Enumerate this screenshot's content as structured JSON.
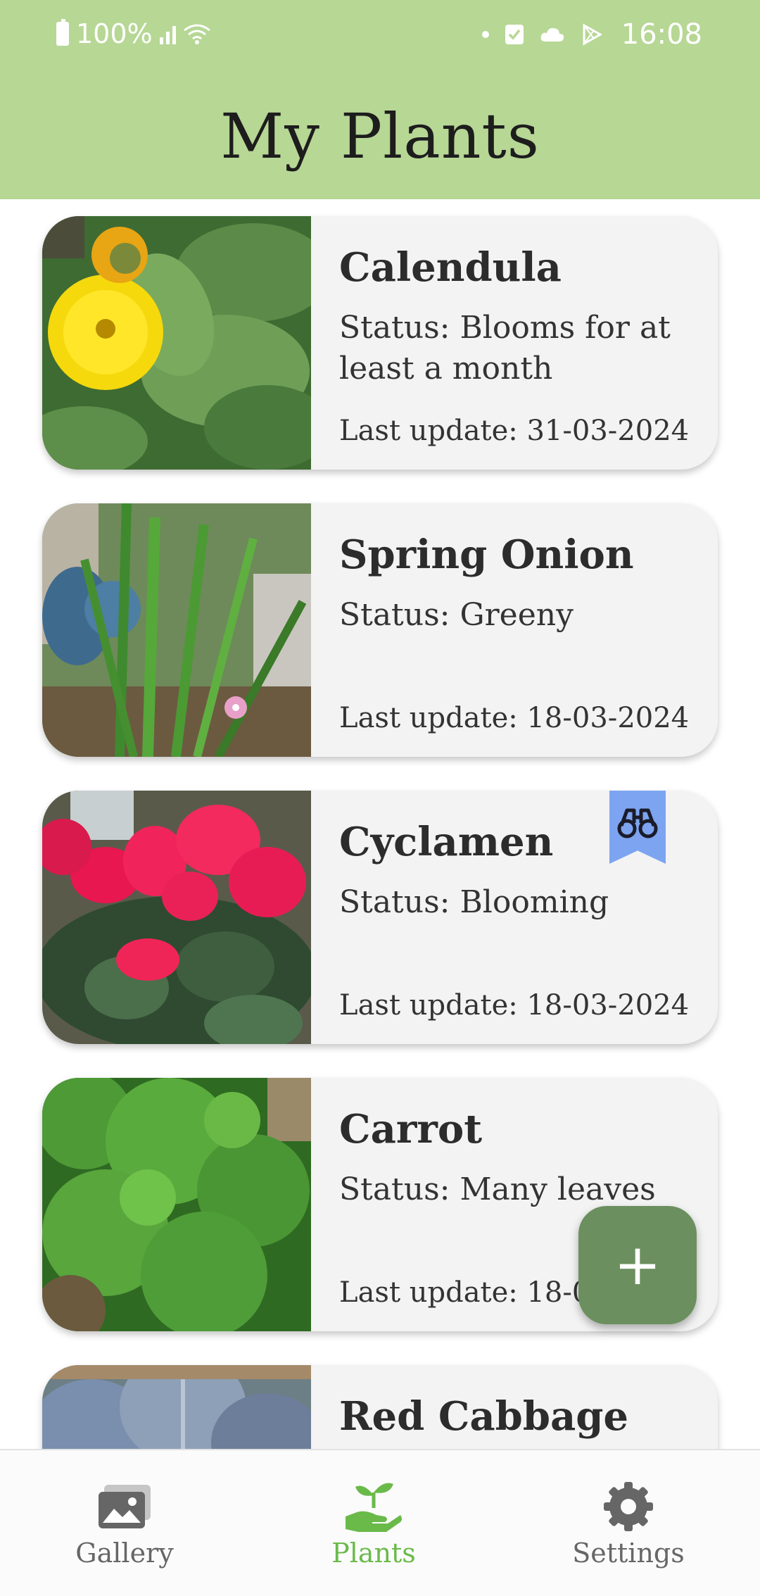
{
  "status_bar": {
    "battery": "100%",
    "time": "16:08"
  },
  "header": {
    "title": "My Plants"
  },
  "plants": [
    {
      "name": "Calendula",
      "status": "Status: Blooms for at least a month",
      "last_update": "Last update: 31-03-2024"
    },
    {
      "name": "Spring Onion",
      "status": "Status: Greeny",
      "last_update": "Last update: 18-03-2024"
    },
    {
      "name": "Cyclamen",
      "status": "Status: Blooming",
      "last_update": "Last update: 18-03-2024",
      "bookmark_icon": "binoculars-icon"
    },
    {
      "name": "Carrot",
      "status": "Status: Many leaves",
      "last_update": "Last update: 18-03-2024"
    },
    {
      "name": "Red Cabbage"
    }
  ],
  "fab": {
    "label": "+",
    "icon": "plus-icon"
  },
  "bottom_nav": {
    "items": [
      {
        "label": "Gallery",
        "icon": "gallery-icon"
      },
      {
        "label": "Plants",
        "icon": "plant-in-hand-icon",
        "active": true
      },
      {
        "label": "Settings",
        "icon": "gear-icon"
      }
    ]
  },
  "colors": {
    "header": "#b7d795",
    "accent": "#6aba4a",
    "fab": "#6b8f5e",
    "bookmark": "#7da4f0",
    "card": "#f3f3f3"
  }
}
